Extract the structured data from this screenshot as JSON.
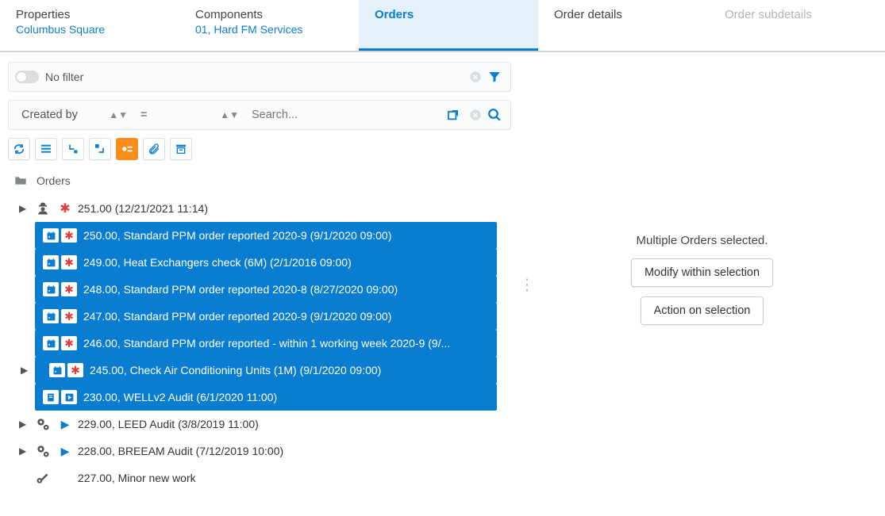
{
  "tabs": [
    {
      "title": "Properties",
      "sub": "Columbus Square"
    },
    {
      "title": "Components",
      "sub": "01, Hard FM Services"
    },
    {
      "title": "Orders",
      "sub": ""
    },
    {
      "title": "Order details",
      "sub": ""
    },
    {
      "title": "Order subdetails",
      "sub": ""
    }
  ],
  "filter": {
    "label": "No filter"
  },
  "search": {
    "createdby": "Created by",
    "op": "=",
    "placeholder": "Search..."
  },
  "tree_root": "Orders",
  "rows": [
    {
      "sel": false,
      "caret": true,
      "icon": "worker",
      "mark": "star",
      "text": "251.00 (12/21/2021 11:14)"
    },
    {
      "sel": true,
      "caret": false,
      "icon": "cal",
      "mark": "star",
      "text": "250.00, Standard PPM order reported 2020-9 (9/1/2020 09:00)"
    },
    {
      "sel": true,
      "caret": false,
      "icon": "cal",
      "mark": "star",
      "text": "249.00, Heat Exchangers check (6M) (2/1/2016 09:00)"
    },
    {
      "sel": true,
      "caret": false,
      "icon": "cal",
      "mark": "star",
      "text": "248.00, Standard PPM order reported 2020-8 (8/27/2020 09:00)"
    },
    {
      "sel": true,
      "caret": false,
      "icon": "cal",
      "mark": "star",
      "text": "247.00, Standard PPM order reported 2020-9 (9/1/2020 09:00)"
    },
    {
      "sel": true,
      "caret": false,
      "icon": "cal",
      "mark": "star",
      "text": "246.00, Standard PPM order reported - within 1 working week 2020-9 (9/..."
    },
    {
      "sel": true,
      "caret": true,
      "icon": "cal",
      "mark": "star",
      "text": "245.00, Check Air Conditioning Units (1M) (9/1/2020 09:00)"
    },
    {
      "sel": true,
      "caret": false,
      "icon": "doc",
      "mark": "play",
      "text": "230.00, WELLv2 Audit (6/1/2020 11:00)"
    },
    {
      "sel": false,
      "caret": true,
      "icon": "gear",
      "mark": "play",
      "text": "229.00, LEED Audit (3/8/2019 11:00)"
    },
    {
      "sel": false,
      "caret": true,
      "icon": "gear",
      "mark": "play",
      "text": "228.00, BREEAM Audit (7/12/2019 10:00)"
    },
    {
      "sel": false,
      "caret": false,
      "icon": "key",
      "mark": "none",
      "text": "227.00, Minor new work"
    }
  ],
  "right": {
    "msg": "Multiple Orders selected.",
    "btn1": "Modify within selection",
    "btn2": "Action on selection"
  }
}
